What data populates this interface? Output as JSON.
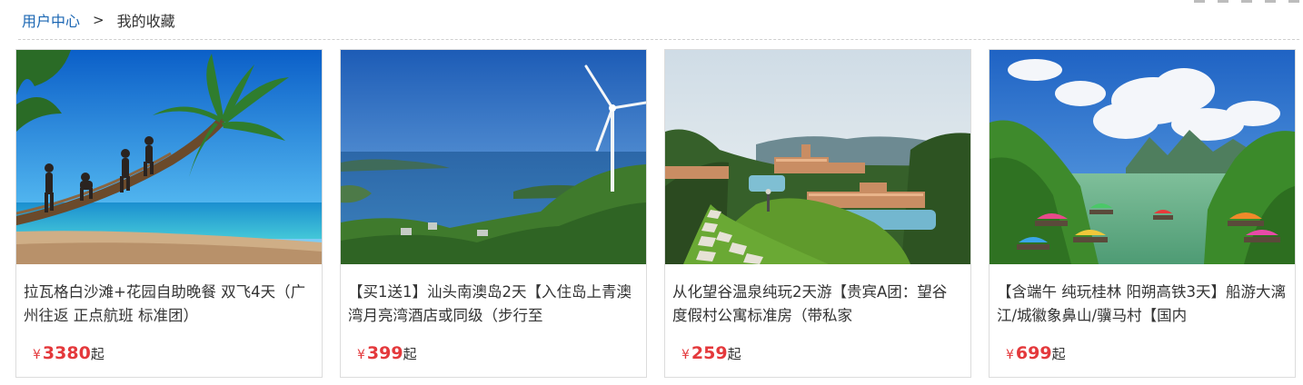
{
  "breadcrumb": {
    "home_label": "用户中心",
    "separator": ">",
    "current_label": "我的收藏"
  },
  "colors": {
    "link": "#1a66b3",
    "price": "#e4393c",
    "border": "#dcdcdc"
  },
  "favorites": [
    {
      "image_subject": "beach-palm-photo",
      "title": "拉瓦格白沙滩+花园自助晚餐 双飞4天（广州往返 正点航班 标准团）",
      "currency": "¥",
      "price": "3380",
      "price_suffix": "起"
    },
    {
      "image_subject": "island-wind-turbine-photo",
      "title": "【买1送1】汕头南澳岛2天【入住岛上青澳湾月亮湾酒店或同级（步行至",
      "currency": "¥",
      "price": "399",
      "price_suffix": "起"
    },
    {
      "image_subject": "hot-spring-resort-photo",
      "title": "从化望谷温泉纯玩2天游【贵宾A团：望谷度假村公寓标准房（带私家",
      "currency": "¥",
      "price": "259",
      "price_suffix": "起"
    },
    {
      "image_subject": "guilin-river-rafting-photo",
      "title": "【含端午 纯玩桂林 阳朔高铁3天】船游大漓江/城徽象鼻山/骥马村【国内",
      "currency": "¥",
      "price": "699",
      "price_suffix": "起"
    }
  ]
}
